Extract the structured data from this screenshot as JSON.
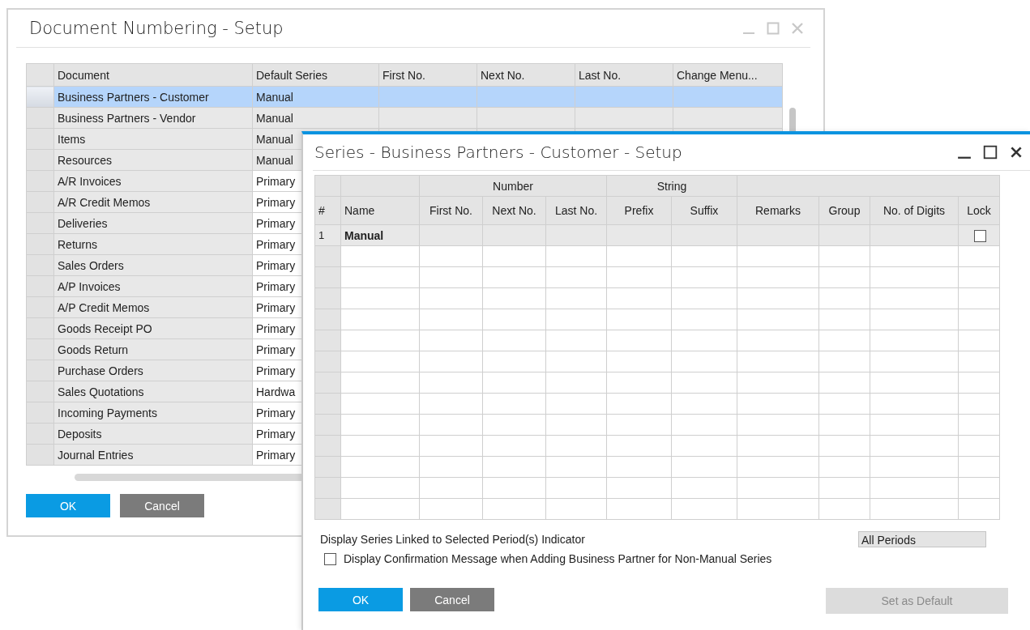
{
  "numbering_window": {
    "title": "Document Numbering - Setup",
    "columns": [
      "Document",
      "Default Series",
      "First No.",
      "Next No.",
      "Last No.",
      "Change Menu..."
    ],
    "rows": [
      {
        "document": "Business Partners - Customer",
        "default_series": "Manual",
        "selected": true,
        "editable": false
      },
      {
        "document": "Business Partners - Vendor",
        "default_series": "Manual",
        "selected": false,
        "editable": false
      },
      {
        "document": "Items",
        "default_series": "Manual",
        "selected": false,
        "editable": false
      },
      {
        "document": "Resources",
        "default_series": "Manual",
        "selected": false,
        "editable": false
      },
      {
        "document": "A/R Invoices",
        "default_series": "Primary",
        "selected": false,
        "editable": true
      },
      {
        "document": "A/R Credit Memos",
        "default_series": "Primary",
        "selected": false,
        "editable": true
      },
      {
        "document": "Deliveries",
        "default_series": "Primary",
        "selected": false,
        "editable": true
      },
      {
        "document": "Returns",
        "default_series": "Primary",
        "selected": false,
        "editable": true
      },
      {
        "document": "Sales Orders",
        "default_series": "Primary",
        "selected": false,
        "editable": true
      },
      {
        "document": "A/P Invoices",
        "default_series": "Primary",
        "selected": false,
        "editable": true
      },
      {
        "document": "A/P Credit Memos",
        "default_series": "Primary",
        "selected": false,
        "editable": true
      },
      {
        "document": "Goods Receipt PO",
        "default_series": "Primary",
        "selected": false,
        "editable": true
      },
      {
        "document": "Goods Return",
        "default_series": "Primary",
        "selected": false,
        "editable": true
      },
      {
        "document": "Purchase Orders",
        "default_series": "Primary",
        "selected": false,
        "editable": true
      },
      {
        "document": "Sales Quotations",
        "default_series": "Hardwa",
        "selected": false,
        "editable": true
      },
      {
        "document": "Incoming Payments",
        "default_series": "Primary",
        "selected": false,
        "editable": true
      },
      {
        "document": "Deposits",
        "default_series": "Primary",
        "selected": false,
        "editable": true
      },
      {
        "document": "Journal Entries",
        "default_series": "Primary",
        "selected": false,
        "editable": true
      }
    ],
    "ok_button": "OK",
    "cancel_button": "Cancel"
  },
  "series_window": {
    "title": "Series - Business Partners - Customer - Setup",
    "group_headers": [
      "Number",
      "String"
    ],
    "columns": [
      "#",
      "Name",
      "First No.",
      "Next No.",
      "Last No.",
      "Prefix",
      "Suffix",
      "Remarks",
      "Group",
      "No. of Digits",
      "Lock"
    ],
    "rows": [
      {
        "number": "1",
        "name": "Manual",
        "lock": false
      }
    ],
    "period_label": "Display Series Linked to Selected Period(s) Indicator",
    "period_value": "All Periods",
    "confirm_checkbox": {
      "label": "Display Confirmation Message when Adding Business Partner for Non-Manual Series",
      "checked": false
    },
    "ok_button": "OK",
    "cancel_button": "Cancel",
    "default_button": {
      "label": "Set as Default",
      "disabled": true
    }
  }
}
